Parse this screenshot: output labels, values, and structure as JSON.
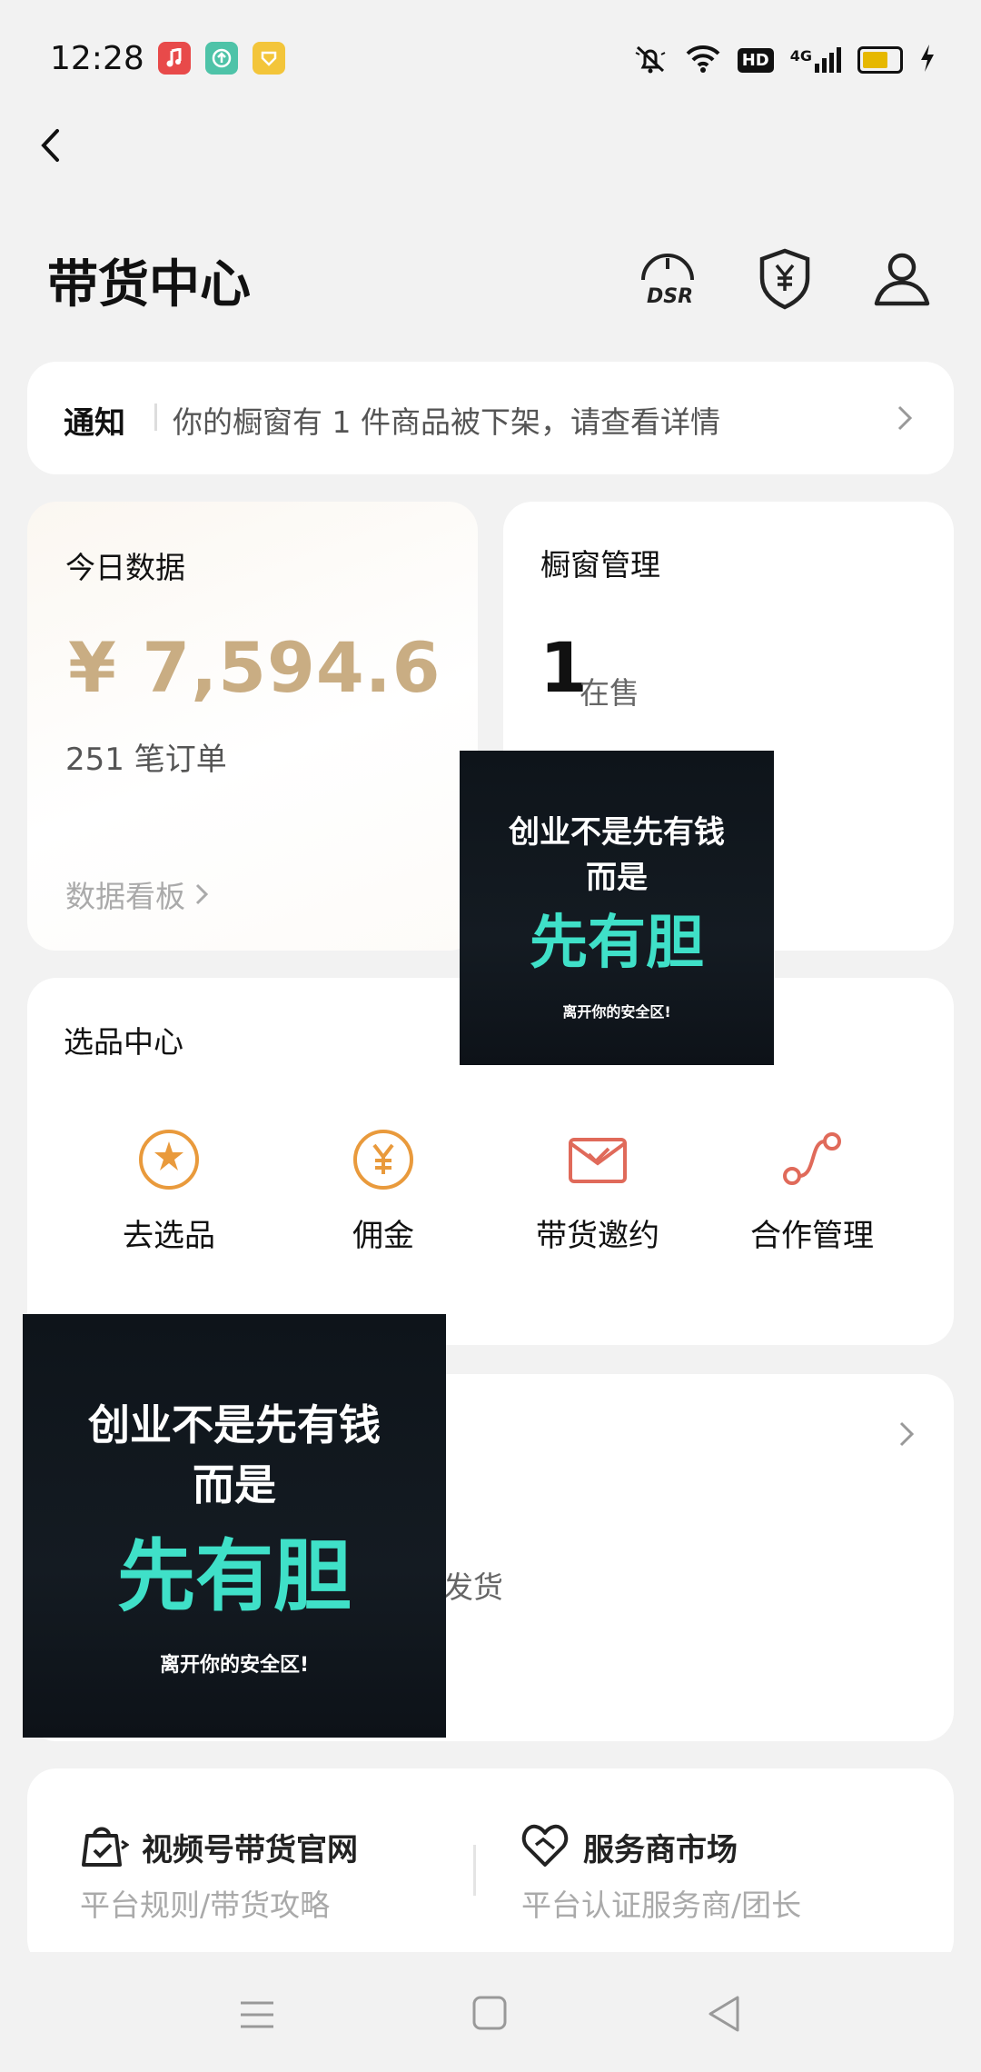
{
  "status_bar": {
    "time": "12:28",
    "network": "4G",
    "hd_label": "HD",
    "battery_level": 0.7,
    "app_icons": [
      "music-app-icon",
      "upload-app-icon",
      "heart-app-icon"
    ]
  },
  "header": {
    "title": "带货中心",
    "dsr_label": "DSR"
  },
  "notice": {
    "label": "通知",
    "text": "你的橱窗有 1 件商品被下架，请查看详情"
  },
  "today_data": {
    "title": "今日数据",
    "amount": "¥ 7,594.6",
    "orders": "251 笔订单",
    "board_link": "数据看板"
  },
  "window_manage": {
    "title": "橱窗管理",
    "count": "1",
    "count_label": "在售"
  },
  "selection_center": {
    "title": "选品中心",
    "items": [
      {
        "label": "去选品",
        "icon": "select-product-icon"
      },
      {
        "label": "佣金",
        "icon": "commission-icon"
      },
      {
        "label": "带货邀约",
        "icon": "invitation-icon"
      },
      {
        "label": "合作管理",
        "icon": "cooperation-icon"
      }
    ]
  },
  "order_card": {
    "partial_text": "待发货"
  },
  "promo": {
    "line1": "创业不是先有钱",
    "line2": "而是",
    "line3": "先有胆",
    "line4": "离开你的安全区!"
  },
  "links": [
    {
      "title": "视频号带货官网",
      "subtitle": "平台规则/带货攻略"
    },
    {
      "title": "服务商市场",
      "subtitle": "平台认证服务商/团长"
    }
  ],
  "colors": {
    "accent_gold": "#c9ad83",
    "icon_orange": "#e99a3c",
    "icon_red": "#e06a5a",
    "promo_teal": "#3fe0c8"
  }
}
